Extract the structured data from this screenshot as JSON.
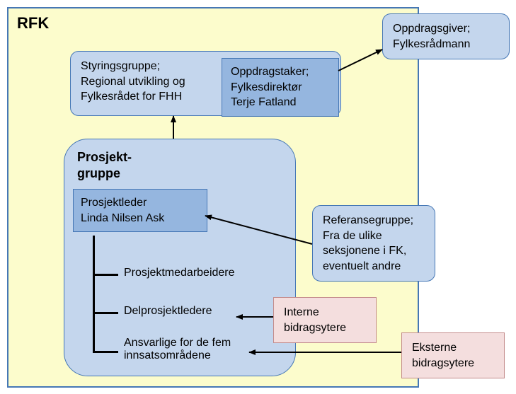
{
  "rfk_title": "RFK",
  "steering": {
    "l1": "Styringsgruppe;",
    "l2": "Regional utvikling og",
    "l3": "Fylkesrådet for FHH"
  },
  "taker": {
    "l1": "Oppdragstaker;",
    "l2": "Fylkesdirektør",
    "l3": "Terje Fatland"
  },
  "giver": {
    "l1": "Oppdragsgiver;",
    "l2": "Fylkesrådmann"
  },
  "project": {
    "title_l1": "Prosjekt-",
    "title_l2": "gruppe",
    "leader_l1": "Prosjektleder",
    "leader_l2": "Linda Nilsen Ask",
    "item1": "Prosjektmedarbeidere",
    "item2": "Delprosjektledere",
    "item3_l1": "Ansvarlige for de fem",
    "item3_l2": "innsatsområdene"
  },
  "reference": {
    "l1": "Referansegruppe;",
    "l2": "Fra de ulike",
    "l3": "seksjonene i FK,",
    "l4": "eventuelt andre"
  },
  "internal": {
    "l1": "Interne",
    "l2": "bidragsytere"
  },
  "external": {
    "l1": "Eksterne",
    "l2": "bidragsytere"
  }
}
